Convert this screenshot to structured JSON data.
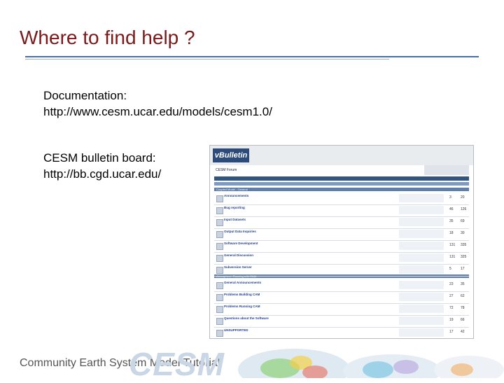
{
  "slide": {
    "title": "Where to find help ?",
    "docs_label": "Documentation:",
    "docs_url": "http://www.cesm.ucar.edu/models/cesm1.0/",
    "bb_label": "CESM bulletin board:",
    "bb_url": "http://bb.cgd.ucar.edu/"
  },
  "screenshot": {
    "logo": "vBulletin",
    "breadcrumb": "CESM Forum",
    "categories": [
      "Coupled Model - General",
      "Atmosphere: Running with CAM"
    ],
    "forums": [
      {
        "name": "Announcements",
        "threads": "3",
        "posts": "20"
      },
      {
        "name": "Bug reporting",
        "threads": "46",
        "posts": "126"
      },
      {
        "name": "Input Datasets",
        "threads": "35",
        "posts": "69"
      },
      {
        "name": "Output Data Inquiries",
        "threads": "18",
        "posts": "30"
      },
      {
        "name": "Software Development",
        "threads": "131",
        "posts": "335"
      },
      {
        "name": "General Discussion",
        "threads": "131",
        "posts": "325"
      },
      {
        "name": "Subversion Server",
        "threads": "5",
        "posts": "17"
      },
      {
        "name": "General Announcements",
        "threads": "23",
        "posts": "35"
      },
      {
        "name": "Problems Building CAM",
        "threads": "27",
        "posts": "62"
      },
      {
        "name": "Problems Running CAM",
        "threads": "72",
        "posts": "78"
      },
      {
        "name": "Questions about the Software",
        "threads": "19",
        "posts": "66"
      },
      {
        "name": "UNSUPPORTED",
        "threads": "17",
        "posts": "42"
      }
    ]
  },
  "footer": {
    "text": "Community Earth System Model Tutorial",
    "logo_text": "CESM"
  },
  "colors": {
    "title": "#7a1a1a",
    "rule": "#4a6f9a",
    "vb_header": "#31557f"
  }
}
